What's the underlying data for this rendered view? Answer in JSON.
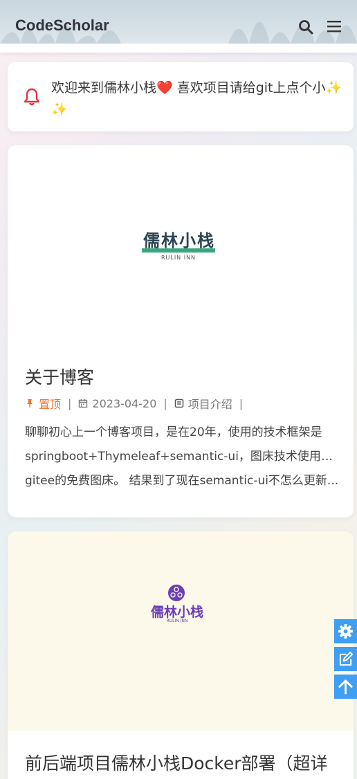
{
  "header": {
    "brand": "CodeScholar"
  },
  "notice": {
    "text": "欢迎来到儒林小栈❤️ 喜欢项目请给git上点个小✨ ✨"
  },
  "posts": [
    {
      "logo_cn": "儒林小栈",
      "logo_en": "RULIN INN",
      "title": "关于博客",
      "pinned_label": "置顶",
      "date": "2023-04-20",
      "category": "项目介绍",
      "excerpt_lines": [
        "聊聊初心上一个博客项目，是在20年，使用的技术框架是",
        "springboot+Thymeleaf+semantic-ui，图床技术使用的是",
        "gitee的免费图床。 结果到了现在semantic-ui不怎么更新..."
      ]
    },
    {
      "logo_cn": "儒林小栈",
      "logo_en": "RULIN INN",
      "title": "前后端项目儒林小栈Docker部署（超详"
    }
  ],
  "icons": {
    "header": [
      "search-icon",
      "menu-icon"
    ],
    "notice": "bell-icon",
    "meta": [
      "pin-icon",
      "calendar-icon",
      "category-icon"
    ],
    "floating": [
      "gear-icon",
      "edit-icon",
      "arrow-up-icon"
    ]
  },
  "colors": {
    "accent": "#3e9ff4",
    "pin": "#ef7132",
    "bell": "#e8333a",
    "logo_green": "#3aa67d",
    "logo_purple": "#6b3fb5"
  }
}
